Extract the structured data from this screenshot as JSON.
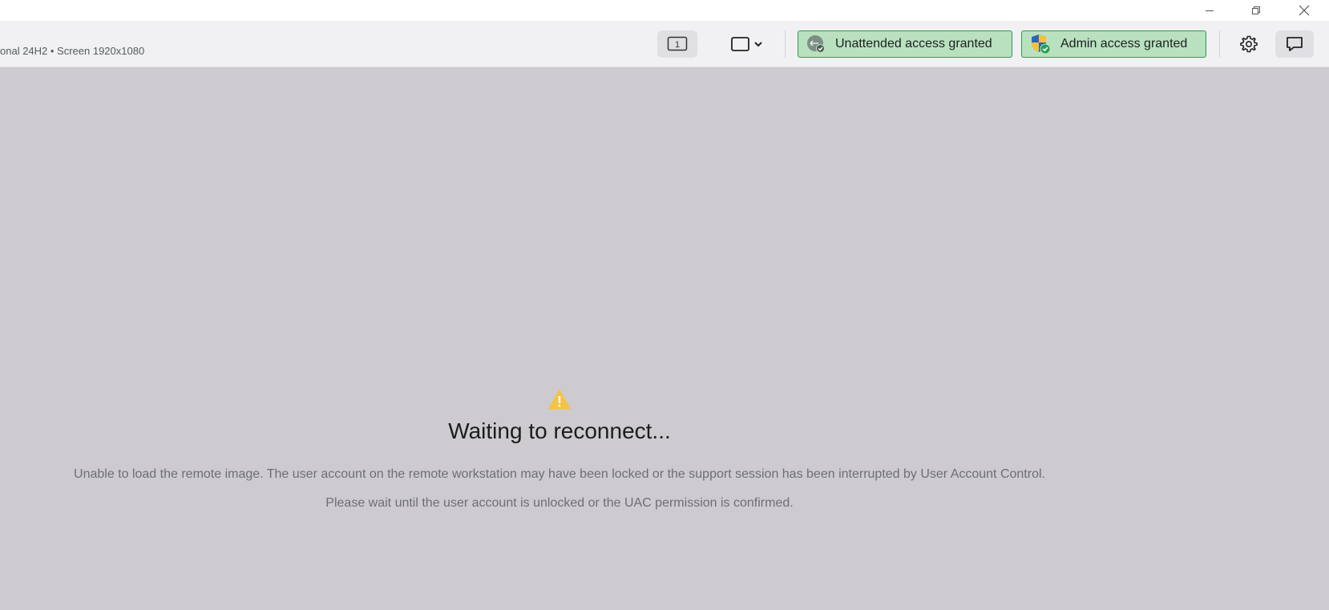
{
  "session": {
    "info": "onal 24H2 • Screen 1920x1080"
  },
  "toolbar": {
    "monitor_number": "1",
    "unattended_label": "Unattended access granted",
    "admin_label": "Admin access granted"
  },
  "status": {
    "headline": "Waiting to reconnect...",
    "message_line1": "Unable to load the remote image. The user account on the remote workstation may have been locked or the support session has been interrupted by User Account Control.",
    "message_line2": "Please wait until the user account is unlocked or the UAC permission is confirmed."
  },
  "colors": {
    "badge_fill": "#b9e1bf",
    "badge_border": "#2f9a48",
    "warning": "#f5c343",
    "background": "#cdcbcf"
  },
  "icons": {
    "minimize": "minimize-icon",
    "restore": "restore-icon",
    "close": "close-icon",
    "monitor": "monitor-icon",
    "view": "view-mode-icon",
    "chevron": "chevron-down-icon",
    "unattended": "unattended-access-icon",
    "admin": "admin-shield-icon",
    "settings": "gear-icon",
    "chat": "chat-icon",
    "warning": "warning-icon"
  }
}
